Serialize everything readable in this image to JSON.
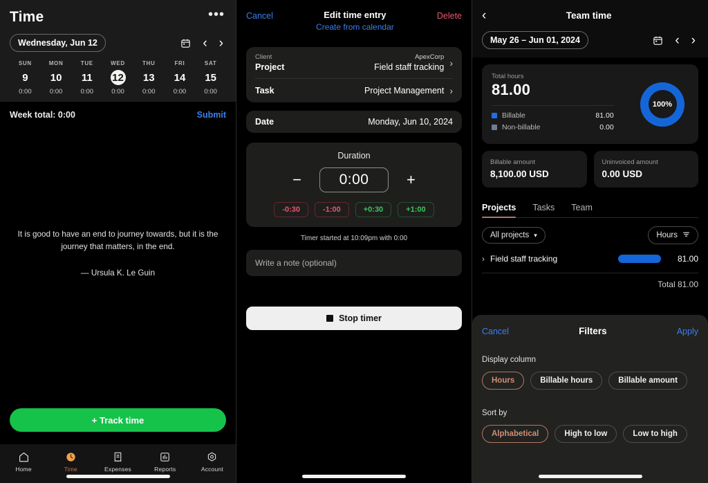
{
  "panel1": {
    "title": "Time",
    "menu_icon": "ellipsis-icon",
    "date_pill": "Wednesday, Jun 12",
    "calendar_icon": "calendar-icon",
    "prev_icon": "chevron-left-icon",
    "next_icon": "chevron-right-icon",
    "week": [
      {
        "dow": "SUN",
        "day": "9",
        "hours": "0:00",
        "selected": false
      },
      {
        "dow": "MON",
        "day": "10",
        "hours": "0:00",
        "selected": false
      },
      {
        "dow": "TUE",
        "day": "11",
        "hours": "0:00",
        "selected": false
      },
      {
        "dow": "WED",
        "day": "12",
        "hours": "0:00",
        "selected": true
      },
      {
        "dow": "THU",
        "day": "13",
        "hours": "0:00",
        "selected": false
      },
      {
        "dow": "FRI",
        "day": "14",
        "hours": "0:00",
        "selected": false
      },
      {
        "dow": "SAT",
        "day": "15",
        "hours": "0:00",
        "selected": false
      }
    ],
    "week_total": "Week total: 0:00",
    "submit": "Submit",
    "quote": "It is good to have an end to journey towards, but it is the journey that matters, in the end.",
    "quote_author": "— Ursula K. Le Guin",
    "track_button": "+ Track time",
    "tabs": [
      {
        "label": "Home",
        "icon": "home-icon",
        "active": false
      },
      {
        "label": "Time",
        "icon": "clock-icon",
        "active": true
      },
      {
        "label": "Expenses",
        "icon": "receipt-icon",
        "active": false
      },
      {
        "label": "Reports",
        "icon": "chart-icon",
        "active": false
      },
      {
        "label": "Account",
        "icon": "account-icon",
        "active": false
      }
    ]
  },
  "panel2": {
    "cancel": "Cancel",
    "title": "Edit time entry",
    "subtitle": "Create from calendar",
    "delete": "Delete",
    "client_label": "Client",
    "client_value": "ApexCorp",
    "project_label": "Project",
    "project_value": "Field staff tracking",
    "task_label": "Task",
    "task_value": "Project Management",
    "date_label": "Date",
    "date_value": "Monday, Jun 10, 2024",
    "duration_title": "Duration",
    "minus": "−",
    "plus": "+",
    "duration_value": "0:00",
    "chips": [
      {
        "label": "-0:30",
        "kind": "neg"
      },
      {
        "label": "-1:00",
        "kind": "neg"
      },
      {
        "label": "+0:30",
        "kind": "pos"
      },
      {
        "label": "+1:00",
        "kind": "pos"
      }
    ],
    "timer_note": "Timer started at 10:09pm with 0:00",
    "note_placeholder": "Write a note (optional)",
    "stop_button": "Stop timer"
  },
  "panel3": {
    "back_icon": "chevron-left-icon",
    "title": "Team time",
    "date_pill": "May 26 – Jun 01, 2024",
    "calendar_icon": "calendar-icon",
    "prev_icon": "chevron-left-icon",
    "next_icon": "chevron-right-icon",
    "total_hours_label": "Total hours",
    "total_hours_value": "81.00",
    "donut_percent": "100%",
    "donut_color": "#1466d8",
    "legend": [
      {
        "label": "Billable",
        "value": "81.00",
        "color": "#1f6fe0"
      },
      {
        "label": "Non-billable",
        "value": "0.00",
        "color": "#6d7f95"
      }
    ],
    "billable_amount_label": "Billable amount",
    "billable_amount_value": "8,100.00 USD",
    "uninvoiced_amount_label": "Uninvoiced amount",
    "uninvoiced_amount_value": "0.00 USD",
    "tabs": [
      {
        "label": "Projects",
        "active": true
      },
      {
        "label": "Tasks",
        "active": false
      },
      {
        "label": "Team",
        "active": false
      }
    ],
    "project_select": "All projects",
    "chevron_down_icon": "chevron-down-icon",
    "hours_filter": "Hours",
    "filter_icon": "filter-icon",
    "rows": [
      {
        "name": "Field staff tracking",
        "value": "81.00",
        "bar_pct": 100
      }
    ],
    "total_row": "Total  81.00",
    "sheet": {
      "cancel": "Cancel",
      "title": "Filters",
      "apply": "Apply",
      "display_column_label": "Display column",
      "display_column_options": [
        {
          "label": "Hours",
          "selected": true
        },
        {
          "label": "Billable hours",
          "selected": false
        },
        {
          "label": "Billable amount",
          "selected": false
        }
      ],
      "sort_by_label": "Sort by",
      "sort_by_options": [
        {
          "label": "Alphabetical",
          "selected": true
        },
        {
          "label": "High to low",
          "selected": false
        },
        {
          "label": "Low to high",
          "selected": false
        }
      ]
    }
  }
}
